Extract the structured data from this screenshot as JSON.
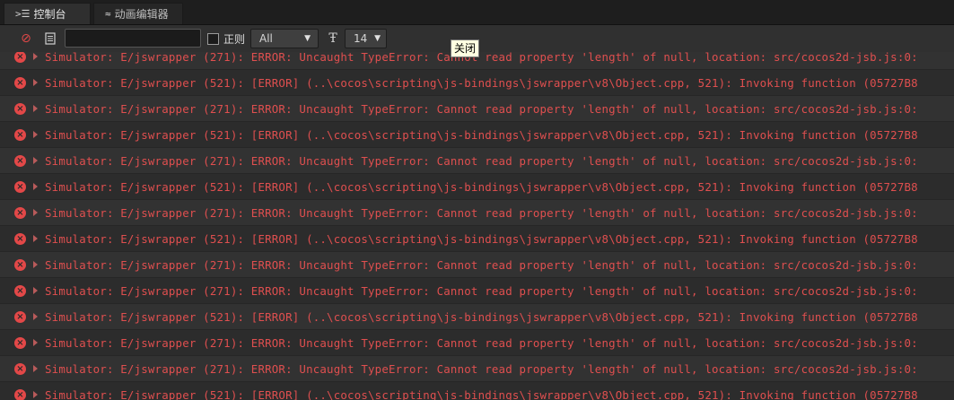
{
  "tabs": [
    {
      "icon": ">☰",
      "label": "控制台"
    },
    {
      "icon": "≈",
      "label": "动画编辑器"
    }
  ],
  "toolbar": {
    "search_value": "",
    "regex_label": "正则",
    "level_selected": "All",
    "font_size_selected": "14"
  },
  "tooltip": "关闭",
  "log": {
    "rows": [
      "Simulator: E/jswrapper (271): ERROR: Uncaught TypeError: Cannot read property 'length' of null, location: src/cocos2d-jsb.js:0:",
      "Simulator: E/jswrapper (521): [ERROR] (..\\cocos\\scripting\\js-bindings\\jswrapper\\v8\\Object.cpp, 521): Invoking function (05727B8",
      "Simulator: E/jswrapper (271): ERROR: Uncaught TypeError: Cannot read property 'length' of null, location: src/cocos2d-jsb.js:0:",
      "Simulator: E/jswrapper (521): [ERROR] (..\\cocos\\scripting\\js-bindings\\jswrapper\\v8\\Object.cpp, 521): Invoking function (05727B8",
      "Simulator: E/jswrapper (271): ERROR: Uncaught TypeError: Cannot read property 'length' of null, location: src/cocos2d-jsb.js:0:",
      "Simulator: E/jswrapper (521): [ERROR] (..\\cocos\\scripting\\js-bindings\\jswrapper\\v8\\Object.cpp, 521): Invoking function (05727B8",
      "Simulator: E/jswrapper (271): ERROR: Uncaught TypeError: Cannot read property 'length' of null, location: src/cocos2d-jsb.js:0:",
      "Simulator: E/jswrapper (521): [ERROR] (..\\cocos\\scripting\\js-bindings\\jswrapper\\v8\\Object.cpp, 521): Invoking function (05727B8",
      "Simulator: E/jswrapper (271): ERROR: Uncaught TypeError: Cannot read property 'length' of null, location: src/cocos2d-jsb.js:0:",
      "Simulator: E/jswrapper (271): ERROR: Uncaught TypeError: Cannot read property 'length' of null, location: src/cocos2d-jsb.js:0:",
      "Simulator: E/jswrapper (521): [ERROR] (..\\cocos\\scripting\\js-bindings\\jswrapper\\v8\\Object.cpp, 521): Invoking function (05727B8",
      "Simulator: E/jswrapper (271): ERROR: Uncaught TypeError: Cannot read property 'length' of null, location: src/cocos2d-jsb.js:0:",
      "Simulator: E/jswrapper (271): ERROR: Uncaught TypeError: Cannot read property 'length' of null, location: src/cocos2d-jsb.js:0:",
      "Simulator: E/jswrapper (521): [ERROR] (..\\cocos\\scripting\\js-bindings\\jswrapper\\v8\\Object.cpp, 521): Invoking function (05727B8"
    ]
  }
}
